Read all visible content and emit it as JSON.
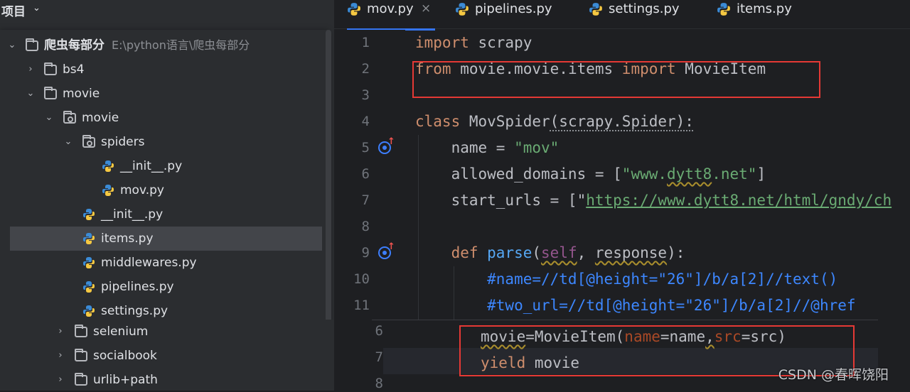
{
  "project_panel": {
    "title": "项目",
    "title_visible": "项目"
  },
  "tree": {
    "root": {
      "label": "爬虫每部分",
      "path": "E:\\python语言\\爬虫每部分"
    },
    "items": [
      {
        "label": "bs4"
      },
      {
        "label": "movie"
      },
      {
        "label": "movie"
      },
      {
        "label": "spiders"
      },
      {
        "label": "__init__.py"
      },
      {
        "label": "mov.py"
      },
      {
        "label": "__init__.py"
      },
      {
        "label": "items.py"
      },
      {
        "label": "middlewares.py"
      },
      {
        "label": "pipelines.py"
      },
      {
        "label": "settings.py"
      }
    ],
    "outer_items": [
      {
        "label": "selenium"
      },
      {
        "label": "socialbook"
      },
      {
        "label": "urlib+path"
      }
    ]
  },
  "tabs": [
    {
      "label": "mov.py",
      "active": true,
      "close": "×"
    },
    {
      "label": "pipelines.py"
    },
    {
      "label": "settings.py"
    },
    {
      "label": "items.py"
    }
  ],
  "line_numbers": [
    "1",
    "2",
    "3",
    "4",
    "5",
    "6",
    "7",
    "8",
    "9",
    "10",
    "11"
  ],
  "code": {
    "l1_kw": "import",
    "l1_rest": " scrapy",
    "l2_kw1": "from",
    "l2_mod": " movie.movie.items ",
    "l2_kw2": "import",
    "l2_name": " MovieItem",
    "l4_kw": "class",
    "l4_name": " MovSpider",
    "l4_rest": "(scrapy.Spider):",
    "l5_name": "    name = ",
    "l5_str": "\"mov\"",
    "l6_a": "    allowed_domains = [",
    "l6_str1": "\"www.",
    "l6_squig": "dytt8",
    "l6_str2": ".net\"",
    "l6_b": "]",
    "l7_a": "    start_urls = [\"",
    "l7_url": "https://www.dytt8.net/html/gndy/ch",
    "l9_kw": "    def",
    "l9_fn": " parse",
    "l9_a": "(",
    "l9_self": "self",
    "l9_b": ", ",
    "l9_resp": "response",
    "l9_c": "):",
    "l10": "        #name=//td[@height=\"26\"]/b/a[2]//text()",
    "l11": "        #two_url=//td[@height=\"26\"]/b/a[2]//@href"
  },
  "overlay": {
    "line_numbers": [
      "6",
      "7",
      "8"
    ],
    "o1_var": "movie",
    "o1_eq": "=MovieItem(",
    "o1_p1": "name",
    "o1_v1": "=name",
    "o1_comma": ",",
    "o1_p2": "src",
    "o1_v2": "=src)",
    "o2_kw": "yield",
    "o2_var": " movie"
  },
  "watermark": "CSDN @春晖饶阳",
  "colors": {
    "keyword": "#cf8e6d",
    "function": "#56a8f5",
    "string": "#6aab73",
    "comment": "#3d87ff",
    "highlight_box": "#e53935",
    "accent": "#3574f0"
  },
  "icons": {
    "folder": "folder-icon",
    "package": "package-icon",
    "python_file": "python-icon",
    "override": "override-gutter-icon"
  }
}
